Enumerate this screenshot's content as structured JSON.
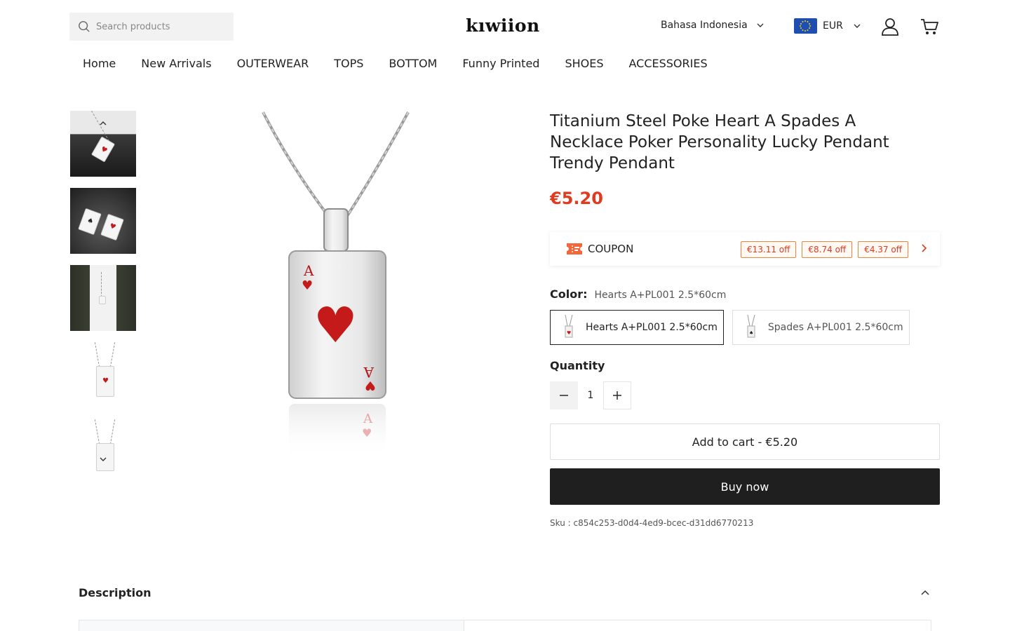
{
  "header": {
    "search_placeholder": "Search products",
    "logo": "kıwiion",
    "language": "Bahasa Indonesia",
    "currency": "EUR"
  },
  "nav": {
    "items": [
      "Home",
      "New Arrivals",
      "OUTERWEAR",
      "TOPS",
      "BOTTOM",
      "Funny Printed",
      "SHOES",
      "ACCESSORIES"
    ]
  },
  "product": {
    "title": "Titanium Steel Poke Heart A Spades A Necklace Poker Personality Lucky Pendant Trendy Pendant",
    "price": "€5.20",
    "coupon_label": "COUPON",
    "coupons": [
      "€13.11 off",
      "€8.74 off",
      "€4.37 off"
    ],
    "color_label": "Color:",
    "color_value": "Hearts A+PL001 2.5*60cm",
    "variants": [
      "Hearts A+PL001 2.5*60cm",
      "Spades A+PL001 2.5*60cm"
    ],
    "quantity_label": "Quantity",
    "quantity": "1",
    "add_to_cart": "Add to cart - €5.20",
    "buy_now": "Buy now",
    "sku": "Sku : c854c253-d0d4-4ed9-bcec-d31dd6770213"
  },
  "description": {
    "title": "Description"
  },
  "colors": {
    "price": "#e03a1f",
    "coupon_border": "#e8863f",
    "buy_now_bg": "#1f1f1f",
    "heart_red": "#c41a1a"
  },
  "icons": [
    "search-icon",
    "chevron-down-icon",
    "eu-flag-icon",
    "user-icon",
    "cart-icon",
    "chevron-up-icon",
    "ticket-icon",
    "chevron-right-icon",
    "minus-icon",
    "plus-icon"
  ]
}
